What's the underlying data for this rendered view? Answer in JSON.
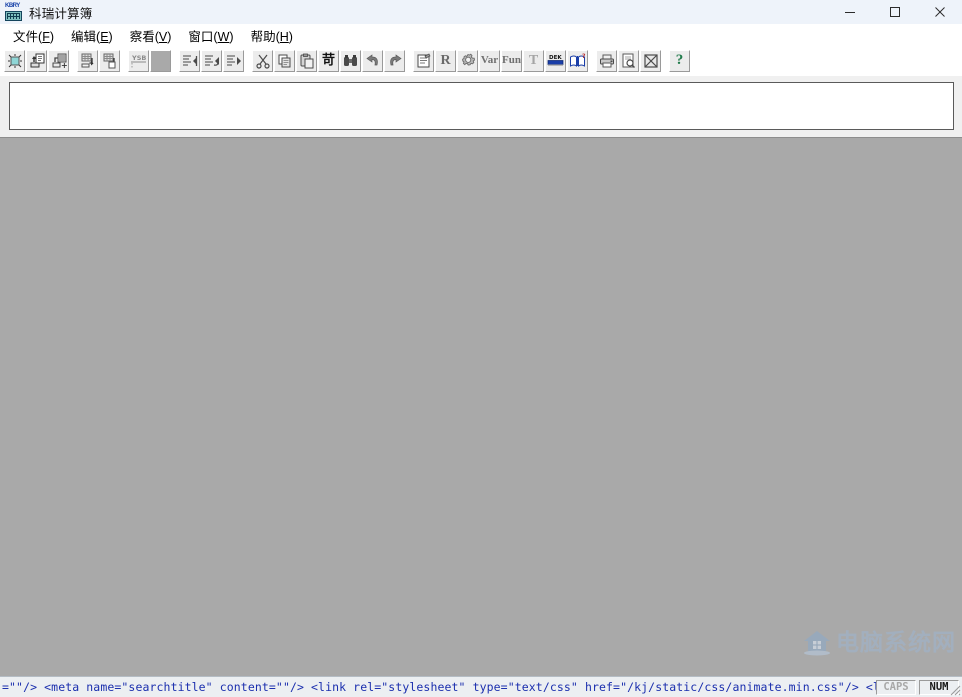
{
  "window": {
    "title": "科瑞计算簿",
    "icon": "calculator-keypad-icon",
    "icon_label": "KBRY",
    "controls": {
      "minimize": "minimize-icon",
      "maximize": "maximize-icon",
      "close": "close-icon"
    }
  },
  "menubar": {
    "items": [
      {
        "label": "文件",
        "accel": "F"
      },
      {
        "label": "编辑",
        "accel": "E"
      },
      {
        "label": "察看",
        "accel": "V"
      },
      {
        "label": "窗口",
        "accel": "W"
      },
      {
        "label": "帮助",
        "accel": "H"
      }
    ]
  },
  "toolbar": {
    "groups": [
      {
        "buttons": [
          {
            "name": "new-document-button",
            "icon": "new-sheet-icon",
            "glyph": "",
            "enabled": true
          },
          {
            "name": "open-document-button",
            "icon": "open-folder-icon",
            "glyph": "",
            "enabled": true
          },
          {
            "name": "save-document-button",
            "icon": "save-add-icon",
            "glyph": "",
            "enabled": true
          }
        ]
      },
      {
        "buttons": [
          {
            "name": "import-data-button",
            "icon": "import-table-icon",
            "glyph": "",
            "enabled": true
          },
          {
            "name": "export-data-button",
            "icon": "export-table-icon",
            "glyph": "",
            "enabled": true
          }
        ]
      },
      {
        "buttons": [
          {
            "name": "ysb-button",
            "icon": "ysb-label-icon",
            "glyph": "YSB",
            "enabled": true
          },
          {
            "name": "blank-button",
            "icon": "blank-icon",
            "glyph": "",
            "enabled": false
          }
        ]
      },
      {
        "buttons": [
          {
            "name": "align-left-button",
            "icon": "align-left-icon",
            "glyph": "",
            "enabled": true
          },
          {
            "name": "align-center-button",
            "icon": "align-center-icon",
            "glyph": "",
            "enabled": true
          },
          {
            "name": "align-right-button",
            "icon": "align-right-icon",
            "glyph": "",
            "enabled": true
          }
        ]
      },
      {
        "buttons": [
          {
            "name": "cut-button",
            "icon": "scissors-icon",
            "glyph": "",
            "enabled": true
          },
          {
            "name": "copy-button",
            "icon": "copy-icon",
            "glyph": "",
            "enabled": true
          },
          {
            "name": "paste-button",
            "icon": "paste-icon",
            "glyph": "",
            "enabled": true
          },
          {
            "name": "insert-character-button",
            "icon": "cjk-character-icon",
            "glyph": "苛",
            "enabled": true
          },
          {
            "name": "find-replace-button",
            "icon": "binoculars-icon",
            "glyph": "",
            "enabled": true
          },
          {
            "name": "undo-button",
            "icon": "undo-arrow-icon",
            "glyph": "",
            "enabled": true
          },
          {
            "name": "redo-button",
            "icon": "redo-arrow-icon",
            "glyph": "",
            "enabled": true
          }
        ]
      },
      {
        "buttons": [
          {
            "name": "properties-button",
            "icon": "properties-clipboard-icon",
            "glyph": "",
            "enabled": true
          },
          {
            "name": "report-button",
            "icon": "letter-r-icon",
            "glyph": "R",
            "enabled": true
          },
          {
            "name": "settings-button",
            "icon": "gear-icon",
            "glyph": "",
            "enabled": true
          },
          {
            "name": "variable-button",
            "icon": "variable-icon",
            "glyph": "Var",
            "enabled": true
          },
          {
            "name": "function-button",
            "icon": "function-icon",
            "glyph": "Fun",
            "enabled": true
          },
          {
            "name": "text-button",
            "icon": "text-t-icon",
            "glyph": "T",
            "enabled": true
          },
          {
            "name": "dek-button",
            "icon": "dek-desk-icon",
            "glyph": "DEK",
            "enabled": true
          },
          {
            "name": "help-book-button",
            "icon": "open-book-question-icon",
            "glyph": "",
            "enabled": true
          }
        ]
      },
      {
        "buttons": [
          {
            "name": "print-button",
            "icon": "printer-icon",
            "glyph": "",
            "enabled": true
          },
          {
            "name": "print-preview-button",
            "icon": "print-preview-icon",
            "glyph": "",
            "enabled": true
          },
          {
            "name": "close-view-button",
            "icon": "crossed-box-icon",
            "glyph": "",
            "enabled": true
          }
        ]
      },
      {
        "buttons": [
          {
            "name": "about-help-button",
            "icon": "question-mark-icon",
            "glyph": "?",
            "enabled": true
          }
        ]
      }
    ]
  },
  "input_panel": {
    "value": "",
    "placeholder": ""
  },
  "workspace": {
    "content": ""
  },
  "watermark": {
    "text": "电脑系统网",
    "icon": "house-logo-icon"
  },
  "statusbar": {
    "code_text": "=\"\"/>      <meta name=\"searchtitle\" content=\"\"/>     <link rel=\"stylesheet\" type=\"text/css\" href=\"/kj/static/css/animate.min.css\"/>     <link rel=\"",
    "indicators": [
      {
        "label": "CAPS",
        "active": false
      },
      {
        "label": "NUM",
        "active": true
      }
    ]
  },
  "colors": {
    "titlebar_bg": "#eef3fa",
    "menubar_bg": "#ffffff",
    "toolbar_bg": "#ffffff",
    "workspace_bg": "#a9a9a9",
    "panel_bg": "#f0f0f0",
    "status_bg": "#eceff2",
    "status_text": "#1b2fae",
    "watermark_text": "#9fb3cc"
  }
}
